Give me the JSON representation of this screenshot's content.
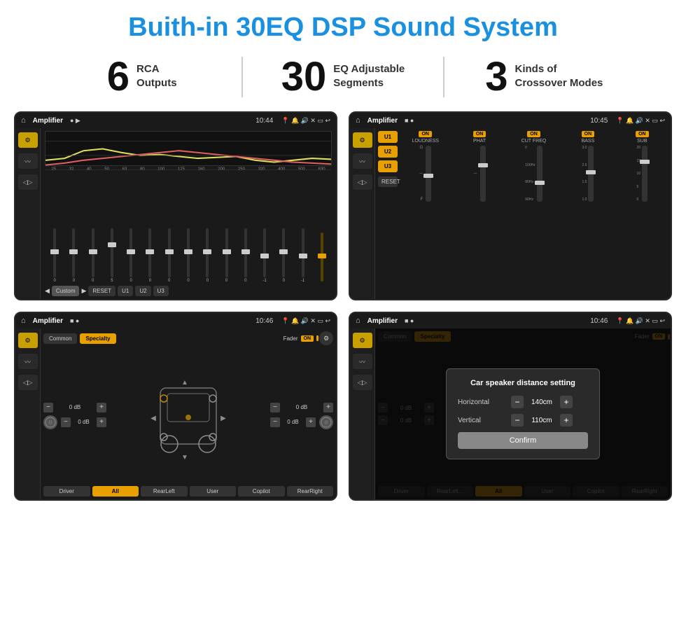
{
  "page": {
    "title": "Buith-in 30EQ DSP Sound System"
  },
  "stats": [
    {
      "number": "6",
      "label": "RCA\nOutputs"
    },
    {
      "number": "30",
      "label": "EQ Adjustable\nSegments"
    },
    {
      "number": "3",
      "label": "Kinds of\nCrossover Modes"
    }
  ],
  "screens": [
    {
      "id": "eq-screen",
      "statusBar": {
        "title": "Amplifier",
        "time": "10:44"
      },
      "type": "eq"
    },
    {
      "id": "amp-screen",
      "statusBar": {
        "title": "Amplifier",
        "time": "10:45"
      },
      "type": "amp"
    },
    {
      "id": "cs-screen",
      "statusBar": {
        "title": "Amplifier",
        "time": "10:46"
      },
      "type": "cs"
    },
    {
      "id": "dialog-screen",
      "statusBar": {
        "title": "Amplifier",
        "time": "10:46"
      },
      "type": "dialog"
    }
  ],
  "eq": {
    "freqs": [
      "25",
      "32",
      "40",
      "50",
      "63",
      "80",
      "100",
      "125",
      "160",
      "200",
      "250",
      "320",
      "400",
      "500",
      "630"
    ],
    "values": [
      "0",
      "0",
      "0",
      "5",
      "0",
      "0",
      "0",
      "0",
      "0",
      "0",
      "0",
      "-1",
      "0",
      "-1",
      ""
    ],
    "presetLabel": "Custom",
    "buttons": [
      "RESET",
      "U1",
      "U2",
      "U3"
    ]
  },
  "amp": {
    "uButtons": [
      "U1",
      "U2",
      "U3"
    ],
    "controls": [
      {
        "label": "LOUDNESS",
        "on": true
      },
      {
        "label": "PHAT",
        "on": true
      },
      {
        "label": "CUT FREQ",
        "on": true
      },
      {
        "label": "BASS",
        "on": true
      },
      {
        "label": "SUB",
        "on": true
      }
    ],
    "resetLabel": "RESET"
  },
  "cs": {
    "tabs": [
      "Common",
      "Specialty"
    ],
    "activeTab": "Specialty",
    "faderLabel": "Fader",
    "faderOn": "ON",
    "dbRows": [
      {
        "left": "0 dB",
        "right": "0 dB"
      },
      {
        "left": "0 dB",
        "right": "0 dB"
      }
    ],
    "bottomButtons": [
      "Driver",
      "RearLeft",
      "All",
      "User",
      "Copilot",
      "RearRight"
    ]
  },
  "dialog": {
    "title": "Car speaker distance setting",
    "horizontal": {
      "label": "Horizontal",
      "value": "140cm"
    },
    "vertical": {
      "label": "Vertical",
      "value": "110cm"
    },
    "confirmLabel": "Confirm",
    "dbRows": [
      {
        "right": "0 dB"
      },
      {
        "right": "0 dB"
      }
    ],
    "bottomRight": [
      "Driver",
      "Copilot"
    ],
    "bottomButtons": [
      "RearLeft..",
      "All",
      "User",
      "RearRight"
    ]
  }
}
